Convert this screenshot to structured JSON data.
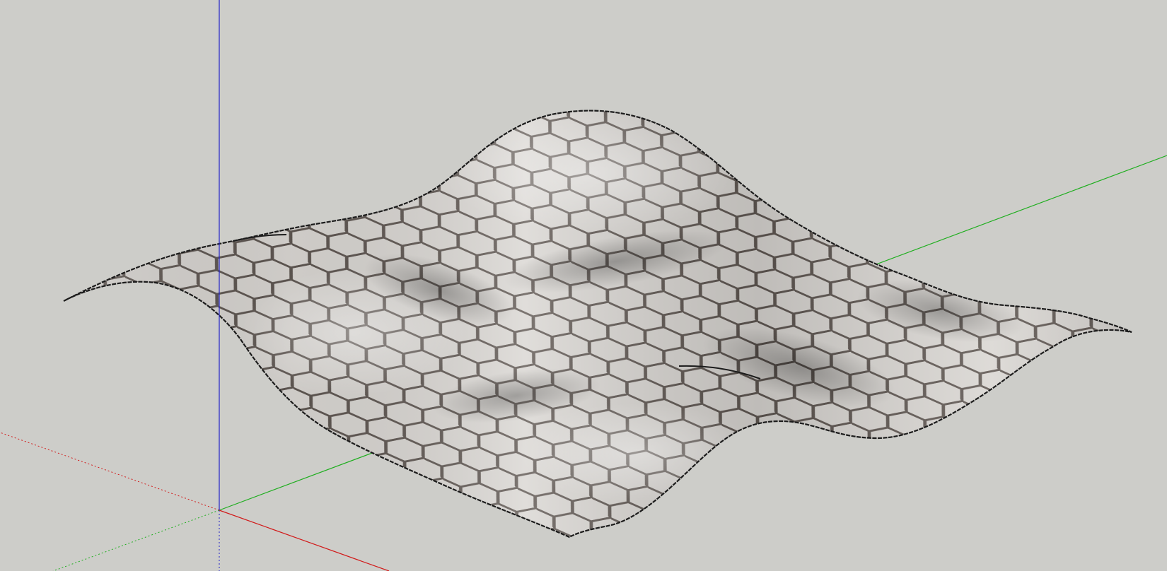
{
  "viewport": {
    "background": "#cdcdc9"
  },
  "axes": {
    "red_axis_color": "#d11a1a",
    "green_axis_color": "#1fae1f",
    "blue_axis_color": "#2424c8"
  },
  "surface": {
    "texture": "hexagon-tile",
    "tile_fill": "#d9d6d2",
    "grout_color": "#5f5752",
    "edge_color": "#1c1c1c"
  }
}
